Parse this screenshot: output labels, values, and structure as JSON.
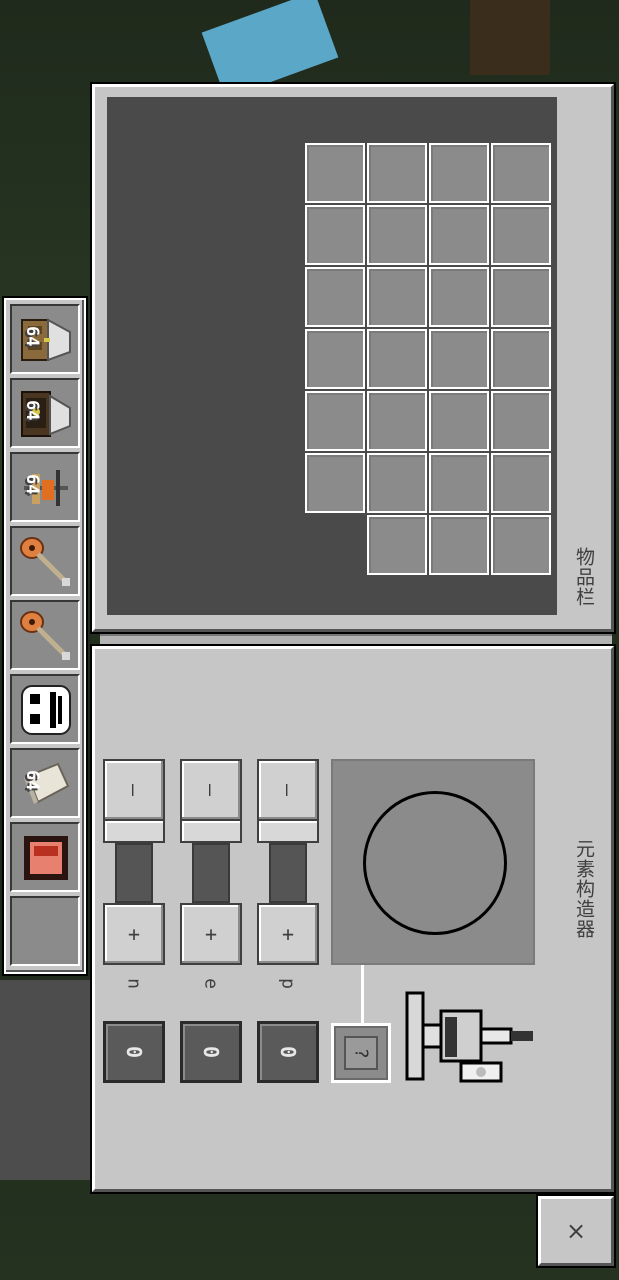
{
  "inventory": {
    "title": "物品栏",
    "grid_layout": {
      "columns": [
        4,
        4,
        4,
        4,
        4,
        4,
        3
      ]
    }
  },
  "hotbar": {
    "slots": [
      {
        "item": "crafting-table-block-icon",
        "count": "64"
      },
      {
        "item": "bookshelf-enchant-block-icon",
        "count": "64"
      },
      {
        "item": "lab-stand-block-icon",
        "count": "64"
      },
      {
        "item": "guitar-icon",
        "count": ""
      },
      {
        "item": "guitar-icon",
        "count": ""
      },
      {
        "item": "skull-face-icon",
        "count": ""
      },
      {
        "item": "iron-ingot-icon",
        "count": "64"
      },
      {
        "item": "redstone-block-icon",
        "count": ""
      },
      {
        "item": "empty-slot",
        "count": ""
      }
    ]
  },
  "constructor": {
    "title": "元素构造器",
    "sliders": [
      {
        "label": "n",
        "minus": "—",
        "plus": "+",
        "value": "0"
      },
      {
        "label": "e",
        "minus": "—",
        "plus": "+",
        "value": "0"
      },
      {
        "label": "p",
        "minus": "—",
        "plus": "+",
        "value": "0"
      }
    ],
    "result_placeholder": "?"
  },
  "close_button": {
    "label": "×"
  },
  "colors": {
    "panel": "#c6c6c6",
    "slot": "#8b8b8b",
    "dark_area": "#4a4a4a",
    "text": "#3f3f3f"
  }
}
